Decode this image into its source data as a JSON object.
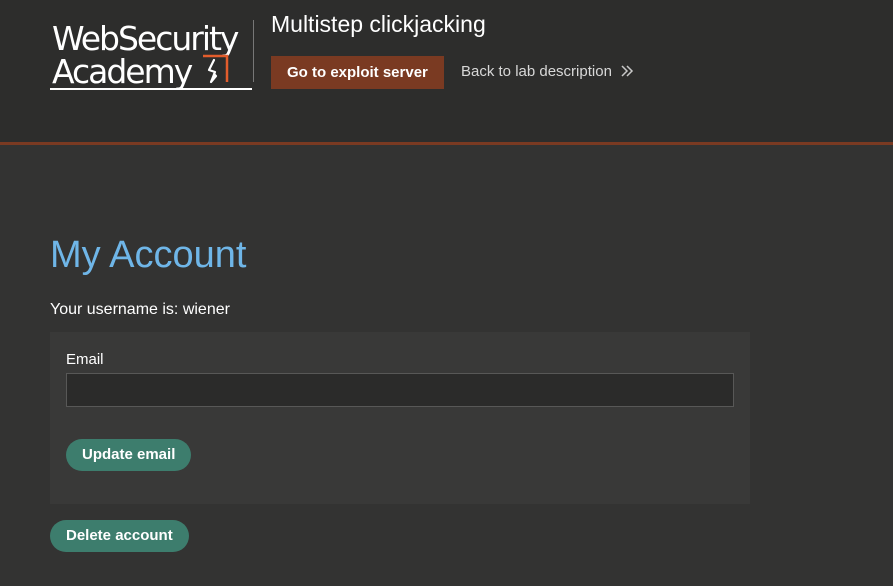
{
  "header": {
    "logo": {
      "line1": "WebSecurity",
      "line2": "Academy"
    },
    "lab_title": "Multistep clickjacking",
    "exploit_button": "Go to exploit server",
    "back_link": "Back to lab description"
  },
  "main": {
    "title": "My Account",
    "username_line": "Your username is: wiener",
    "email_form": {
      "label": "Email",
      "value": "",
      "placeholder": "",
      "submit": "Update email"
    },
    "delete_button": "Delete account"
  },
  "colors": {
    "accent_orange": "#7a3a22",
    "title_blue": "#6fb6e8",
    "button_green": "#3d7d6d"
  },
  "icons": {
    "logo_mark": "academy-lightning-icon",
    "back_chevron": "double-chevron-right-icon"
  }
}
